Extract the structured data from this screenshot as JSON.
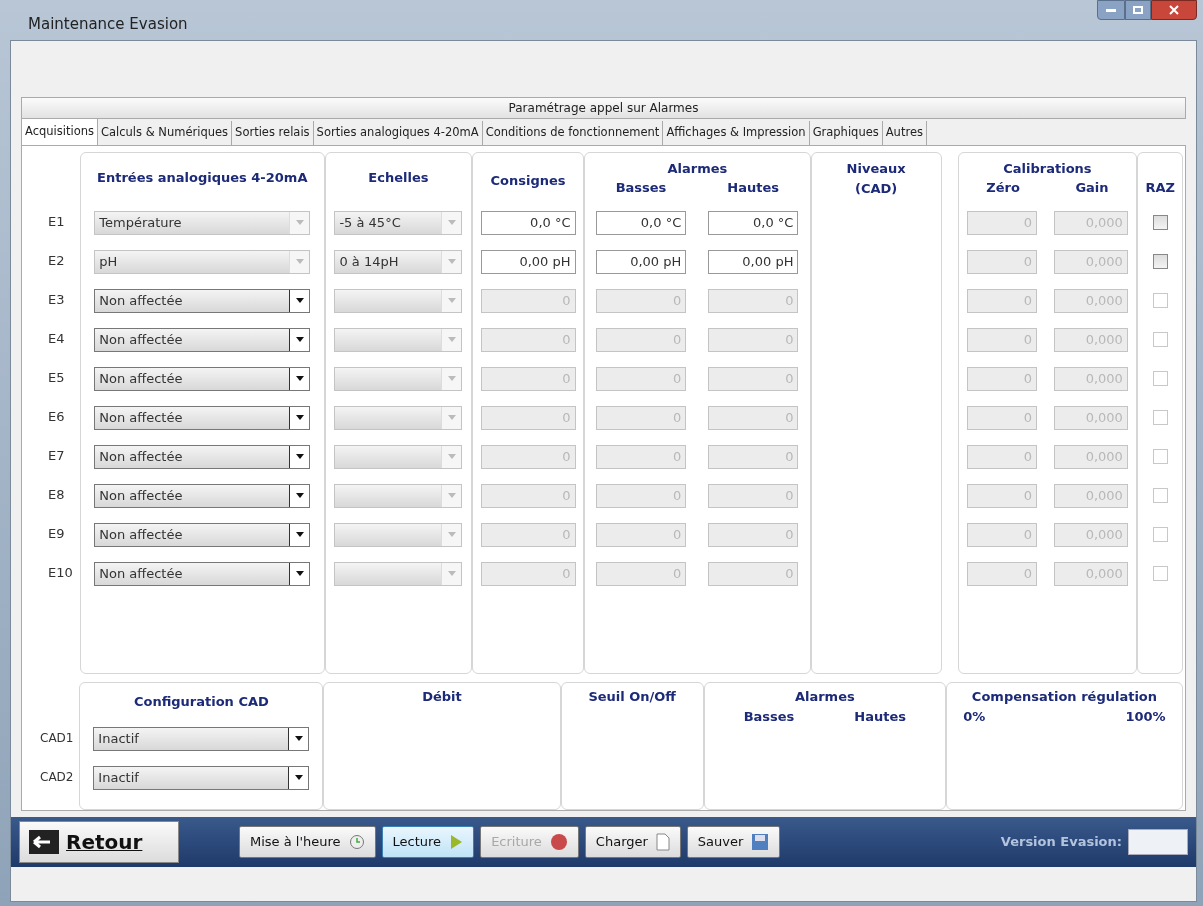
{
  "window": {
    "title": "Maintenance Evasion"
  },
  "header": "Paramétrage appel sur Alarmes",
  "tabs": [
    {
      "label": "Acquisitions",
      "selected": true
    },
    {
      "label": "Calculs & Numériques",
      "selected": false
    },
    {
      "label": "Sorties relais",
      "selected": false
    },
    {
      "label": "Sorties analogiques 4-20mA",
      "selected": false
    },
    {
      "label": "Conditions de fonctionnement",
      "selected": false
    },
    {
      "label": "Affichages & Impression",
      "selected": false
    },
    {
      "label": "Graphiques",
      "selected": false
    },
    {
      "label": "Autres",
      "selected": false
    }
  ],
  "groups": {
    "inputs": "Entrées analogiques 4-20mA",
    "scales": "Echelles",
    "setpoints": "Consignes",
    "alarms": "Alarmes",
    "low": "Basses",
    "high": "Hautes",
    "levels": "Niveaux",
    "levels_sub": "(CAD)",
    "calibrations": "Calibrations",
    "zero": "Zéro",
    "gain": "Gain",
    "reset": "RAZ"
  },
  "rows": [
    {
      "label": "E1",
      "input": {
        "value": "Température",
        "disabled": true
      },
      "scale": {
        "value": "-5 à 45°C",
        "disabled": true
      },
      "setpoint": {
        "value": "0,0 °C",
        "disabled": false
      },
      "low": {
        "value": "0,0 °C",
        "disabled": false
      },
      "high": {
        "value": "0,0 °C",
        "disabled": false
      },
      "zero": {
        "value": "0",
        "disabled": true
      },
      "gain": {
        "value": "0,000",
        "disabled": true
      },
      "reset": {
        "checked": false,
        "disabled": false
      }
    },
    {
      "label": "E2",
      "input": {
        "value": "pH",
        "disabled": true
      },
      "scale": {
        "value": "0 à 14pH",
        "disabled": true
      },
      "setpoint": {
        "value": "0,00 pH",
        "disabled": false
      },
      "low": {
        "value": "0,00 pH",
        "disabled": false
      },
      "high": {
        "value": "0,00 pH",
        "disabled": false
      },
      "zero": {
        "value": "0",
        "disabled": true
      },
      "gain": {
        "value": "0,000",
        "disabled": true
      },
      "reset": {
        "checked": false,
        "disabled": false
      }
    },
    {
      "label": "E3",
      "input": {
        "value": "Non affectée",
        "disabled": false
      },
      "scale": {
        "disabled": true
      },
      "setpoint": {
        "value": "0",
        "disabled": true
      },
      "low": {
        "value": "0",
        "disabled": true
      },
      "high": {
        "value": "0",
        "disabled": true
      },
      "zero": {
        "value": "0",
        "disabled": true
      },
      "gain": {
        "value": "0,000",
        "disabled": true
      },
      "reset": {
        "checked": false,
        "disabled": true
      }
    },
    {
      "label": "E4",
      "input": {
        "value": "Non affectée",
        "disabled": false
      },
      "scale": {
        "disabled": true
      },
      "setpoint": {
        "value": "0",
        "disabled": true
      },
      "low": {
        "value": "0",
        "disabled": true
      },
      "high": {
        "value": "0",
        "disabled": true
      },
      "zero": {
        "value": "0",
        "disabled": true
      },
      "gain": {
        "value": "0,000",
        "disabled": true
      },
      "reset": {
        "checked": false,
        "disabled": true
      }
    },
    {
      "label": "E5",
      "input": {
        "value": "Non affectée",
        "disabled": false
      },
      "scale": {
        "disabled": true
      },
      "setpoint": {
        "value": "0",
        "disabled": true
      },
      "low": {
        "value": "0",
        "disabled": true
      },
      "high": {
        "value": "0",
        "disabled": true
      },
      "zero": {
        "value": "0",
        "disabled": true
      },
      "gain": {
        "value": "0,000",
        "disabled": true
      },
      "reset": {
        "checked": false,
        "disabled": true
      }
    },
    {
      "label": "E6",
      "input": {
        "value": "Non affectée",
        "disabled": false
      },
      "scale": {
        "disabled": true
      },
      "setpoint": {
        "value": "0",
        "disabled": true
      },
      "low": {
        "value": "0",
        "disabled": true
      },
      "high": {
        "value": "0",
        "disabled": true
      },
      "zero": {
        "value": "0",
        "disabled": true
      },
      "gain": {
        "value": "0,000",
        "disabled": true
      },
      "reset": {
        "checked": false,
        "disabled": true
      }
    },
    {
      "label": "E7",
      "input": {
        "value": "Non affectée",
        "disabled": false
      },
      "scale": {
        "disabled": true
      },
      "setpoint": {
        "value": "0",
        "disabled": true
      },
      "low": {
        "value": "0",
        "disabled": true
      },
      "high": {
        "value": "0",
        "disabled": true
      },
      "zero": {
        "value": "0",
        "disabled": true
      },
      "gain": {
        "value": "0,000",
        "disabled": true
      },
      "reset": {
        "checked": false,
        "disabled": true
      }
    },
    {
      "label": "E8",
      "input": {
        "value": "Non affectée",
        "disabled": false
      },
      "scale": {
        "disabled": true
      },
      "setpoint": {
        "value": "0",
        "disabled": true
      },
      "low": {
        "value": "0",
        "disabled": true
      },
      "high": {
        "value": "0",
        "disabled": true
      },
      "zero": {
        "value": "0",
        "disabled": true
      },
      "gain": {
        "value": "0,000",
        "disabled": true
      },
      "reset": {
        "checked": false,
        "disabled": true
      }
    },
    {
      "label": "E9",
      "input": {
        "value": "Non affectée",
        "disabled": false
      },
      "scale": {
        "disabled": true
      },
      "setpoint": {
        "value": "0",
        "disabled": true
      },
      "low": {
        "value": "0",
        "disabled": true
      },
      "high": {
        "value": "0",
        "disabled": true
      },
      "zero": {
        "value": "0",
        "disabled": true
      },
      "gain": {
        "value": "0,000",
        "disabled": true
      },
      "reset": {
        "checked": false,
        "disabled": true
      }
    },
    {
      "label": "E10",
      "input": {
        "value": "Non affectée",
        "disabled": false
      },
      "scale": {
        "disabled": true
      },
      "setpoint": {
        "value": "0",
        "disabled": true
      },
      "low": {
        "value": "0",
        "disabled": true
      },
      "high": {
        "value": "0",
        "disabled": true
      },
      "zero": {
        "value": "0",
        "disabled": true
      },
      "gain": {
        "value": "0,000",
        "disabled": true
      },
      "reset": {
        "checked": false,
        "disabled": true
      }
    }
  ],
  "cad": {
    "title": "Configuration CAD",
    "rows": [
      {
        "label": "CAD1",
        "value": "Inactif"
      },
      {
        "label": "CAD2",
        "value": "Inactif"
      }
    ],
    "flow": "Débit",
    "threshold": "Seuil On/Off",
    "alarms": "Alarmes",
    "low": "Basses",
    "high": "Hautes",
    "compensation": "Compensation régulation",
    "comp_min": "0%",
    "comp_max": "100%"
  },
  "footer": {
    "back": "Retour",
    "buttons": [
      {
        "label": "Mise à l'heure",
        "kind": "clock",
        "disabled": false,
        "selected": false
      },
      {
        "label": "Lecture",
        "kind": "play",
        "disabled": false,
        "selected": true
      },
      {
        "label": "Ecriture",
        "kind": "record",
        "disabled": true,
        "selected": false
      },
      {
        "label": "Charger",
        "kind": "file",
        "disabled": false,
        "selected": false
      },
      {
        "label": "Sauver",
        "kind": "save",
        "disabled": false,
        "selected": false
      }
    ],
    "version_label": "Version Evasion:"
  }
}
